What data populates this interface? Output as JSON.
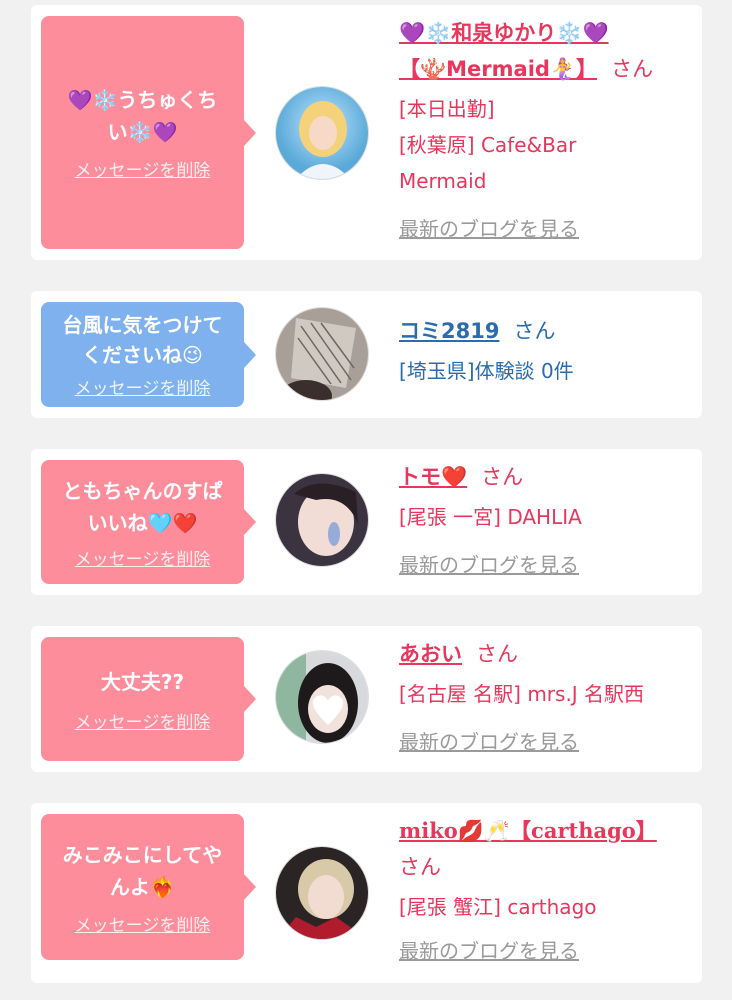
{
  "items": [
    {
      "message": "💜❄️うちゅくち\nい❄️💜",
      "delete_label": "メッセージを削除",
      "name": "💜❄️和泉ゆかり❄️💜\n【🪸Mermaid🧜‍♀️】",
      "honorific": "さん",
      "meta": [
        "[本日出勤]",
        "[秋葉原] Cafe&Bar",
        "Mermaid"
      ],
      "blog_label": "最新のブログを見る",
      "theme": "pink"
    },
    {
      "message": "台風に気をつけて\nくださいね😉",
      "delete_label": "メッセージを削除",
      "name": "コミ2819",
      "honorific": "さん",
      "meta": [
        "[埼玉県]体験談 0件"
      ],
      "theme": "blue"
    },
    {
      "message": "ともちゃんのすぱ\nいいね🩵❤️",
      "delete_label": "メッセージを削除",
      "name": "トモ❤️",
      "honorific": "さん",
      "meta": [
        "[尾張 一宮] DAHLIA"
      ],
      "blog_label": "最新のブログを見る",
      "theme": "pink"
    },
    {
      "message": "大丈夫??",
      "delete_label": "メッセージを削除",
      "name": "あおい",
      "honorific": "さん",
      "meta": [
        "[名古屋 名駅] mrs.J 名駅西"
      ],
      "blog_label": "最新のブログを見る",
      "theme": "pink"
    },
    {
      "message": "みこみこにしてや\nんよ❤️‍🔥",
      "delete_label": "メッセージを削除",
      "name": "miko💋🥂【carthago】",
      "honorific": "さん",
      "meta": [
        "[尾張 蟹江] carthago"
      ],
      "blog_label": "最新のブログを見る",
      "theme": "pink"
    }
  ],
  "colors": {
    "pink_bubble": "#fe8d9c",
    "blue_bubble": "#7fb1ee",
    "pink_text": "#e8365c",
    "blue_text": "#2b6cb0",
    "link_gray": "#9a9a9a"
  }
}
